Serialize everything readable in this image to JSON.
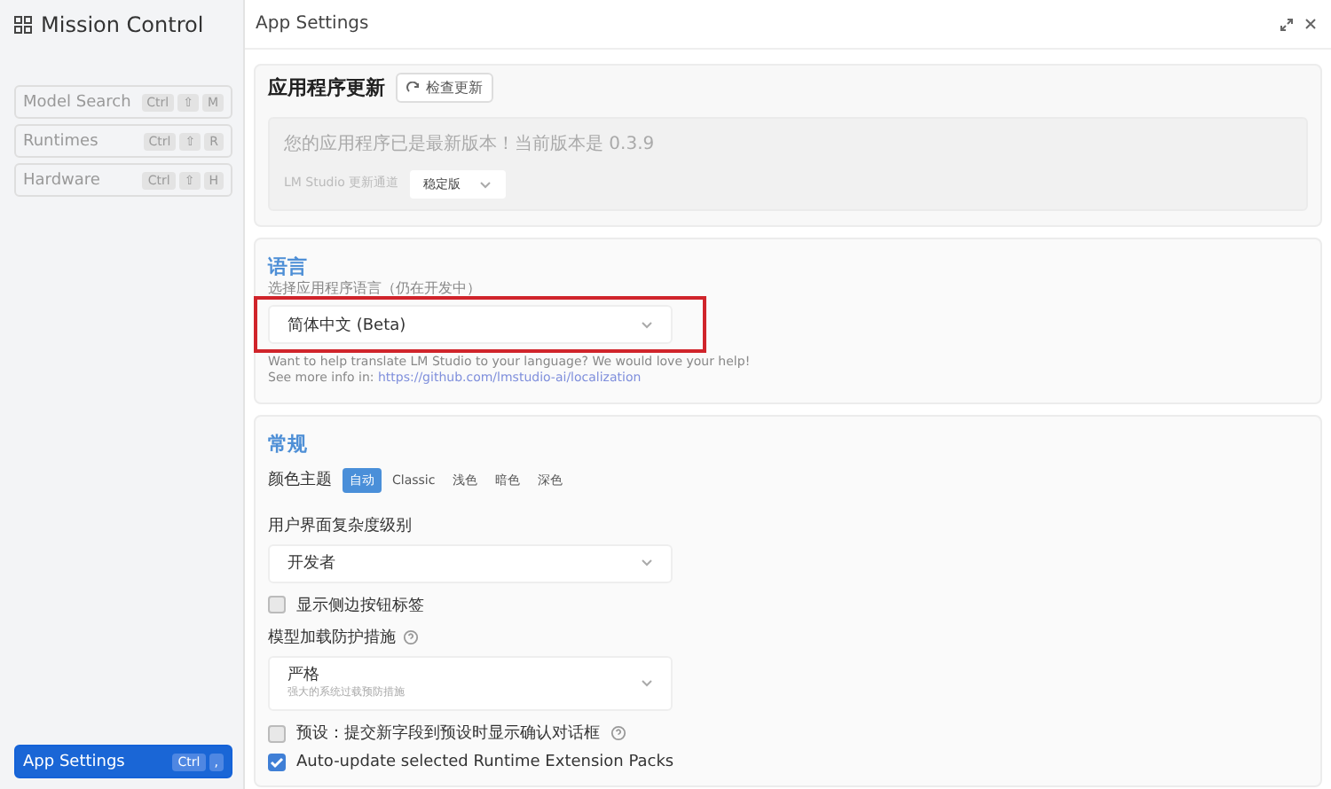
{
  "sidebar": {
    "title": "Mission Control",
    "items": [
      {
        "label": "Model Search",
        "keys": [
          "Ctrl",
          "⇧",
          "M"
        ],
        "selected": false
      },
      {
        "label": "Runtimes",
        "keys": [
          "Ctrl",
          "⇧",
          "R"
        ],
        "selected": false
      },
      {
        "label": "Hardware",
        "keys": [
          "Ctrl",
          "⇧",
          "H"
        ],
        "selected": false
      }
    ],
    "bottom_item": {
      "label": "App Settings",
      "keys": [
        "Ctrl",
        ","
      ],
      "selected": true
    }
  },
  "header": {
    "title": "App Settings"
  },
  "update": {
    "title": "应用程序更新",
    "check_button": "检查更新",
    "status": "您的应用程序已是最新版本！当前版本是 0.3.9",
    "channel_label": "LM Studio 更新通道",
    "channel_value": "稳定版"
  },
  "language": {
    "title": "语言",
    "label": "选择应用程序语言（仍在开发中）",
    "value": "简体中文 (Beta)",
    "highlighted": true,
    "help": "Want to help translate LM Studio to your language? We would love your help!",
    "more_prefix": "See more info in:",
    "link": "https://github.com/lmstudio-ai/localization"
  },
  "general": {
    "title": "常规",
    "theme_label": "颜色主题",
    "themes": [
      {
        "label": "自动",
        "selected": true
      },
      {
        "label": "Classic",
        "selected": false
      },
      {
        "label": "浅色",
        "selected": false
      },
      {
        "label": "暗色",
        "selected": false
      },
      {
        "label": "深色",
        "selected": false
      }
    ],
    "complexity_label": "用户界面复杂度级别",
    "complexity_value": "开发者",
    "sidebar_labels": {
      "label": "显示侧边按钮标签",
      "checked": false
    },
    "guard_label": "模型加载防护措施",
    "guard_value": "严格",
    "guard_hint": "强大的系统过载预防措施",
    "preset_confirm": {
      "label": "预设：提交新字段到预设时显示确认对话框",
      "checked": false
    },
    "auto_update": {
      "label": "Auto-update selected Runtime Extension Packs",
      "checked": true
    }
  }
}
